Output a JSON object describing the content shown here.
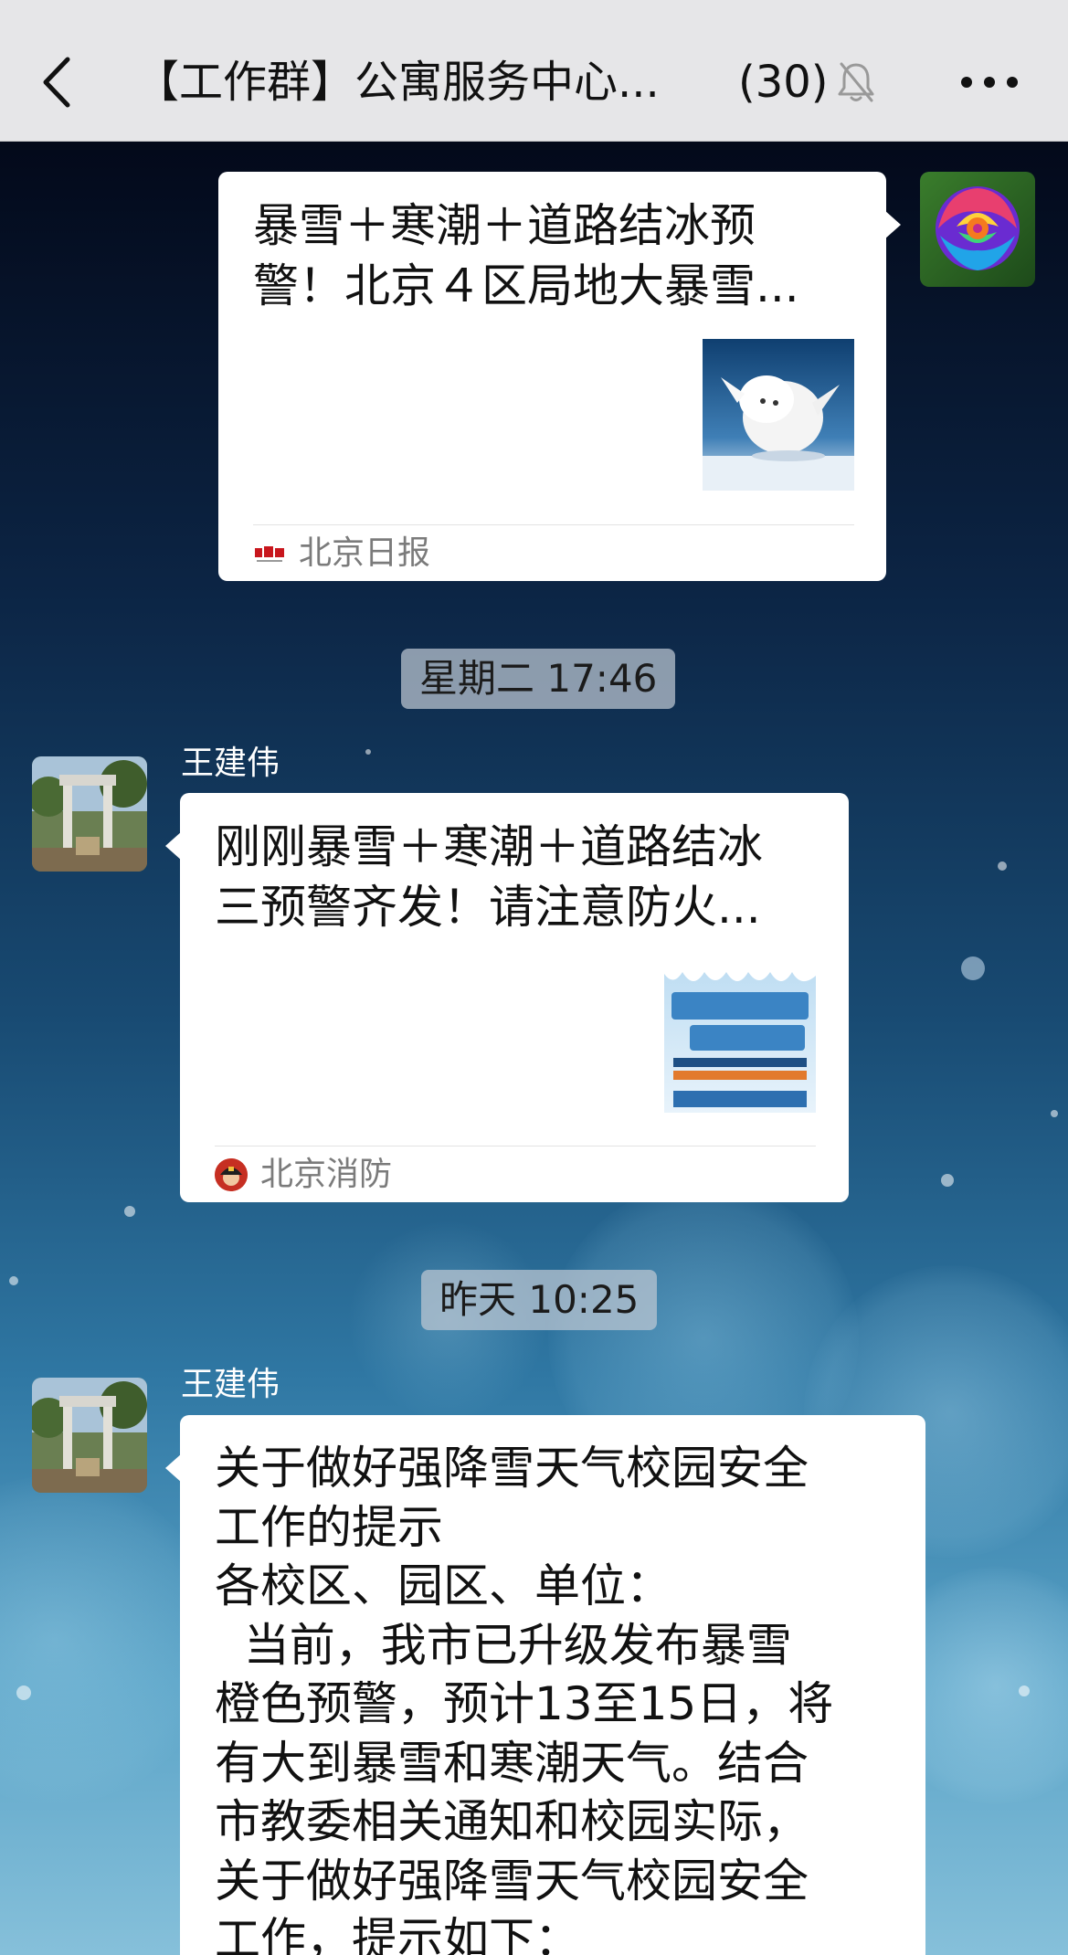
{
  "header": {
    "title": "【工作群】公寓服务中心...",
    "member_count": "(30)"
  },
  "messages": [
    {
      "type": "link_card",
      "direction": "outgoing",
      "title_lines": [
        "暴雪＋寒潮＋道路结冰预",
        "警！北京４区局地大暴雪..."
      ],
      "source": "北京日报",
      "thumbnail": "running-white-dog-in-snow"
    },
    {
      "type": "timestamp",
      "text": "星期二 17:46"
    },
    {
      "type": "link_card",
      "direction": "incoming",
      "sender": "王建伟",
      "title_lines": [
        "刚刚暴雪＋寒潮＋道路结冰",
        "三预警齐发！请注意防火..."
      ],
      "source": "北京消防",
      "thumbnail": "cold-wave-warning-poster"
    },
    {
      "type": "timestamp",
      "text": "昨天 10:25"
    },
    {
      "type": "text",
      "direction": "incoming",
      "sender": "王建伟",
      "lines": [
        "关于做好强降雪天气校园安全",
        "工作的提示",
        "各校区、园区、单位：",
        "  当前，我市已升级发布暴雪",
        "橙色预警，预计13至15日，将",
        "有大到暴雪和寒潮天气。结合",
        "市教委相关通知和校园实际，",
        "关于做好强降雪天气校园安全",
        "工作，提示如下："
      ]
    }
  ],
  "colors": {
    "topbar": "#e6e6e8",
    "bubble": "#ffffff",
    "source_text": "#7b7b7b",
    "time_pill": "#bec8d2"
  },
  "icons": {
    "back": "chevron-left-icon",
    "mute": "bell-off-icon",
    "more": "more-dots-icon"
  }
}
